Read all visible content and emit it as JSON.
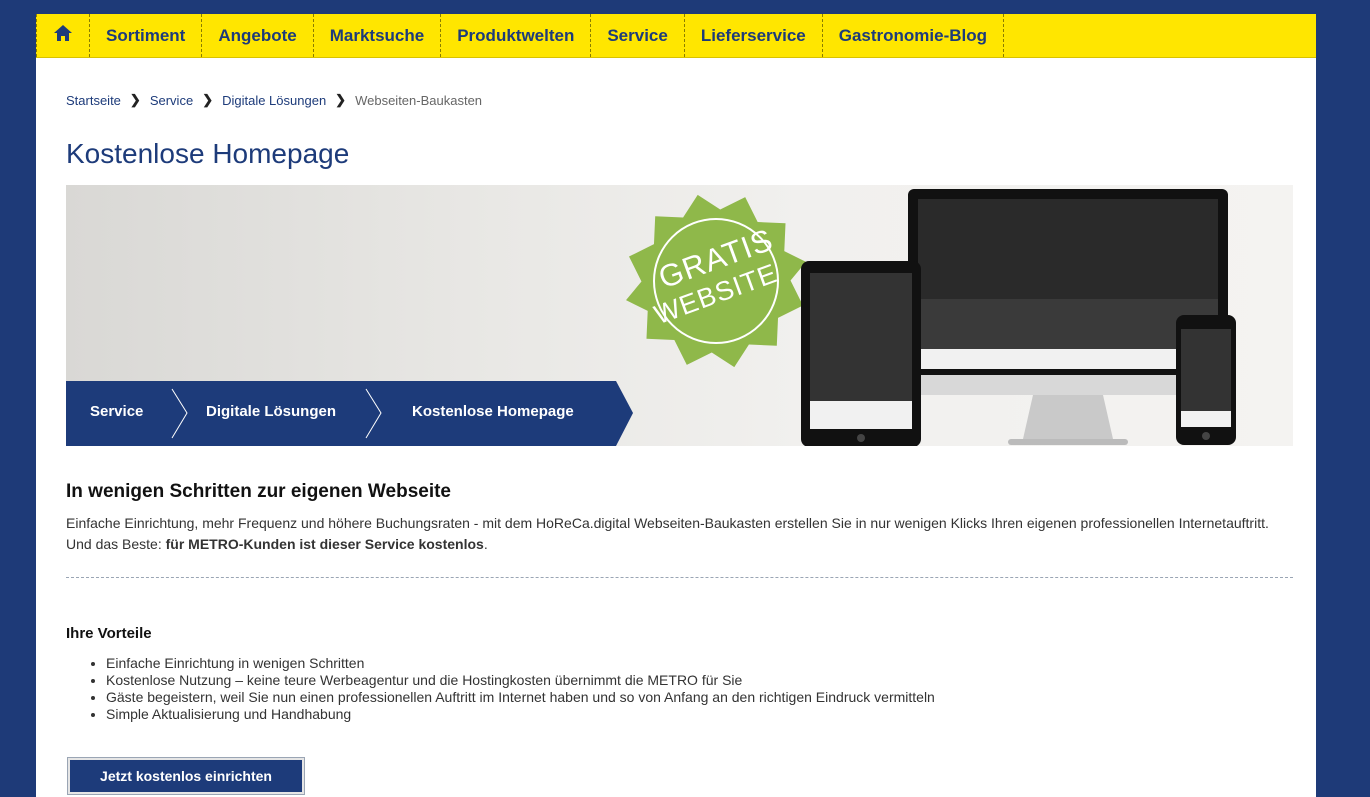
{
  "nav": {
    "home_icon": "home-icon",
    "items": [
      "Sortiment",
      "Angebote",
      "Marktsuche",
      "Produktwelten",
      "Service",
      "Lieferservice",
      "Gastronomie-Blog"
    ]
  },
  "breadcrumb": [
    "Startseite",
    "Service",
    "Digitale Lösungen",
    "Webseiten-Baukasten"
  ],
  "page_title": "Kostenlose Homepage",
  "banner": {
    "nav": [
      "Service",
      "Digitale Lösungen",
      "Kostenlose Homepage"
    ],
    "badge_line1": "GRATIS",
    "badge_line2": "WEBSITE"
  },
  "section": {
    "heading": "In wenigen Schritten zur eigenen Webseite",
    "intro_text": "Einfache Einrichtung, mehr Frequenz und höhere Buchungsraten - mit dem HoReCa.digital Webseiten-Baukasten erstellen Sie in nur wenigen Klicks Ihren eigenen professionellen Internetauftritt. Und das Beste: ",
    "intro_bold": "für METRO-Kunden ist dieser Service kostenlos",
    "intro_end": "."
  },
  "benefits": {
    "heading": "Ihre Vorteile",
    "items": [
      "Einfache Einrichtung in wenigen Schritten",
      "Kostenlose Nutzung – keine teure Werbeagentur und die Hostingkosten übernimmt die METRO für Sie",
      "Gäste begeistern, weil Sie nun einen professionellen Auftritt im Internet haben und so von Anfang an den richtigen Eindruck vermitteln",
      "Simple Aktualisierung und Handhabung"
    ]
  },
  "cta": {
    "label": "Jetzt kostenlos einrichten"
  },
  "colors": {
    "brand_blue": "#1d3b7a",
    "nav_yellow": "#ffe600",
    "badge_green": "#8fb84a",
    "outer_background": "#1e3a78"
  }
}
